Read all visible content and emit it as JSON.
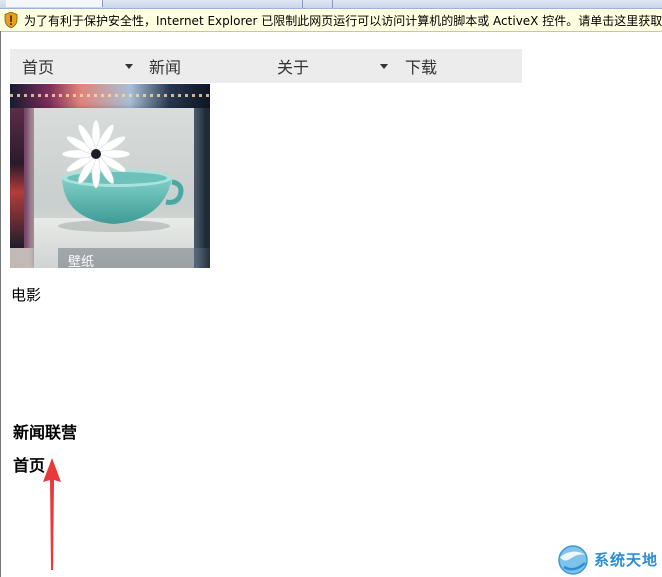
{
  "infobar": {
    "message": "为了有利于保护安全性，Internet Explorer 已限制此网页运行可以访问计算机的脚本或 ActiveX 控件。请单击这里获取选项...",
    "icon": "shield-warning-icon"
  },
  "nav": {
    "items": [
      {
        "label": "首页",
        "has_dropdown": true
      },
      {
        "label": "新闻",
        "has_dropdown": false
      },
      {
        "label": "关于",
        "has_dropdown": true
      },
      {
        "label": "下载",
        "has_dropdown": false
      }
    ]
  },
  "hero": {
    "caption": "壁纸"
  },
  "content": {
    "movie_link": "电影",
    "news_title": "新闻联营",
    "home_title": "首页"
  },
  "watermark": {
    "text": "系统天地"
  },
  "colors": {
    "infobar_bg": "#ffffe1",
    "nav_bg": "#ececec",
    "arrow": "#e83a3a",
    "watermark": "#2a8ed1"
  }
}
